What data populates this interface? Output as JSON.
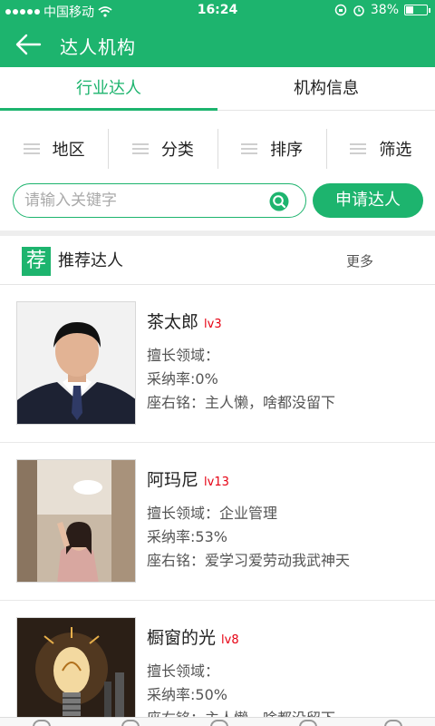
{
  "status_bar": {
    "carrier": "中国移动",
    "time": "16:24",
    "battery": "38%",
    "battery_level": 0.38
  },
  "nav": {
    "title": "达人机构",
    "back_icon": "back-arrow-icon"
  },
  "tabs": [
    {
      "label": "行业达人",
      "active": true
    },
    {
      "label": "机构信息",
      "active": false
    }
  ],
  "filters": [
    {
      "label": "地区",
      "icon": "menu-lines-icon"
    },
    {
      "label": "分类",
      "icon": "menu-lines-icon"
    },
    {
      "label": "排序",
      "icon": "menu-lines-icon"
    },
    {
      "label": "筛选",
      "icon": "menu-lines-icon"
    }
  ],
  "search": {
    "placeholder": "请输入关键字",
    "value": ""
  },
  "apply_button": "申请达人",
  "recommend": {
    "badge": "荐",
    "title": "推荐达人",
    "more": "更多"
  },
  "experts": [
    {
      "name": "茶太郎",
      "level": "lv3",
      "field": "擅长领域：",
      "rate": "采纳率:0%",
      "motto": "座右铭：主人懒，啥都没留下"
    },
    {
      "name": "阿玛尼",
      "level": "lv13",
      "field": "擅长领域：企业管理",
      "rate": "采纳率:53%",
      "motto": "座右铭：爱学习爱劳动我武神天"
    },
    {
      "name": "橱窗的光",
      "level": "lv8",
      "field": "擅长领域：",
      "rate": "采纳率:50%",
      "motto": "座右铭：主人懒，啥都没留下"
    }
  ],
  "colors": {
    "primary": "#1db46e",
    "level": "#e60012"
  }
}
